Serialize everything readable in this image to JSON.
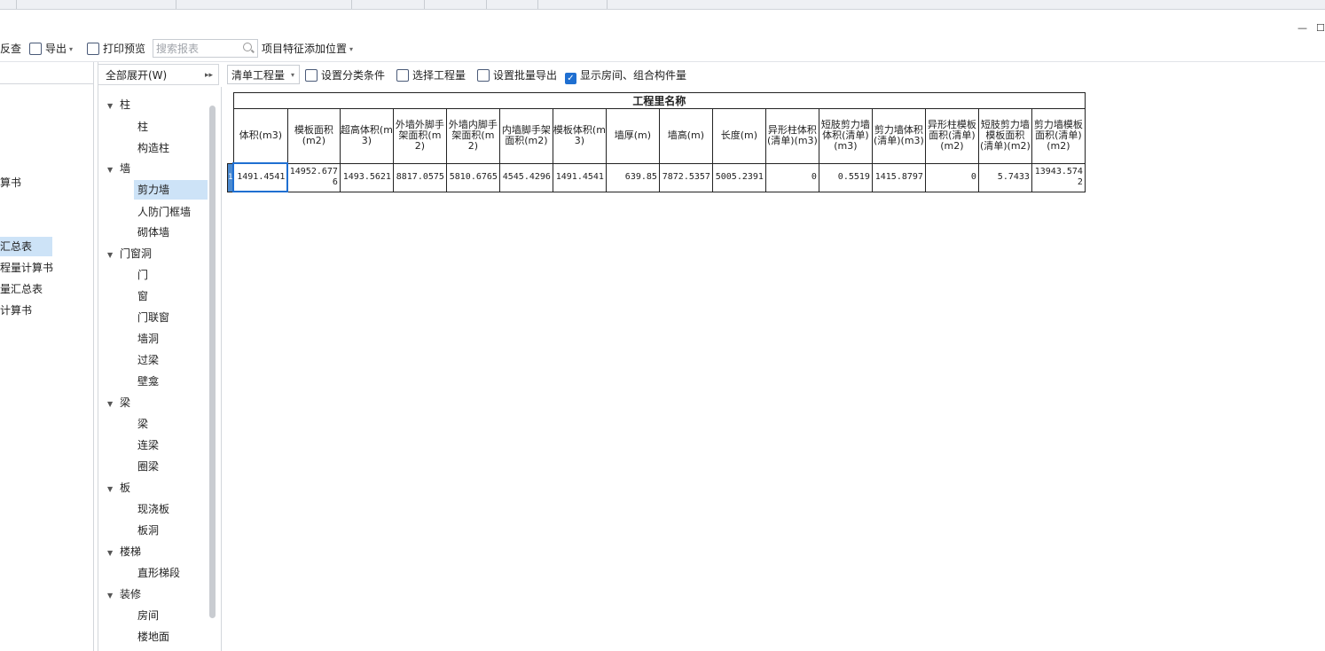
{
  "toolbar": {
    "back_check": "反查",
    "export": "导出",
    "print_preview": "打印预览",
    "search_placeholder": "搜索报表",
    "item_feature_position": "项目特征添加位置"
  },
  "left_pane": {
    "items": [
      {
        "label": "算书"
      },
      {
        "label": "汇总表",
        "selected": true
      },
      {
        "label": "程量计算书"
      },
      {
        "label": "量汇总表"
      },
      {
        "label": "计算书"
      }
    ]
  },
  "tree": {
    "expand_all": "全部展开(W)",
    "groups": [
      {
        "label": "柱",
        "children": [
          "柱",
          "构造柱"
        ]
      },
      {
        "label": "墙",
        "children": [
          "剪力墙",
          "人防门框墙",
          "砌体墙"
        ]
      },
      {
        "label": "门窗洞",
        "children": [
          "门",
          "窗",
          "门联窗",
          "墙洞",
          "过梁",
          "壁龛"
        ]
      },
      {
        "label": "梁",
        "children": [
          "梁",
          "连梁",
          "圈梁"
        ]
      },
      {
        "label": "板",
        "children": [
          "现浇板",
          "板洞"
        ]
      },
      {
        "label": "楼梯",
        "children": [
          "直形梯段"
        ]
      },
      {
        "label": "装修",
        "children": [
          "房间",
          "楼地面"
        ]
      }
    ],
    "selected": "剪力墙"
  },
  "right_toolbar": {
    "list_type": "清单工程量",
    "set_category": "设置分类条件",
    "select_quantity": "选择工程量",
    "batch_export": "设置批量导出",
    "show_rooms": "显示房间、组合构件量",
    "show_rooms_checked": true
  },
  "table": {
    "title": "工程里名称",
    "headers": [
      "体积(m3)",
      "模板面积(m2)",
      "超高体积(m3)",
      "外墙外脚手架面积(m2)",
      "外墙内脚手架面积(m2)",
      "内墙脚手架面积(m2)",
      "模板体积(m3)",
      "墙厚(m)",
      "墙高(m)",
      "长度(m)",
      "异形柱体积(清单)(m3)",
      "短肢剪力墙体积(清单)(m3)",
      "剪力墙体积(清单)(m3)",
      "异形柱模板面积(清单)(m2)",
      "短肢剪力墙模板面积(清单)(m2)",
      "剪力墙模板面积(清单)(m2)"
    ],
    "row_number": "1",
    "rows": [
      [
        "1491.4541",
        "14952.6776",
        "1493.5621",
        "8817.0575",
        "5810.6765",
        "4545.4296",
        "1491.4541",
        "639.85",
        "7872.5357",
        "5005.2391",
        "0",
        "0.5519",
        "1415.8797",
        "0",
        "5.7433",
        "13943.5742"
      ]
    ]
  }
}
